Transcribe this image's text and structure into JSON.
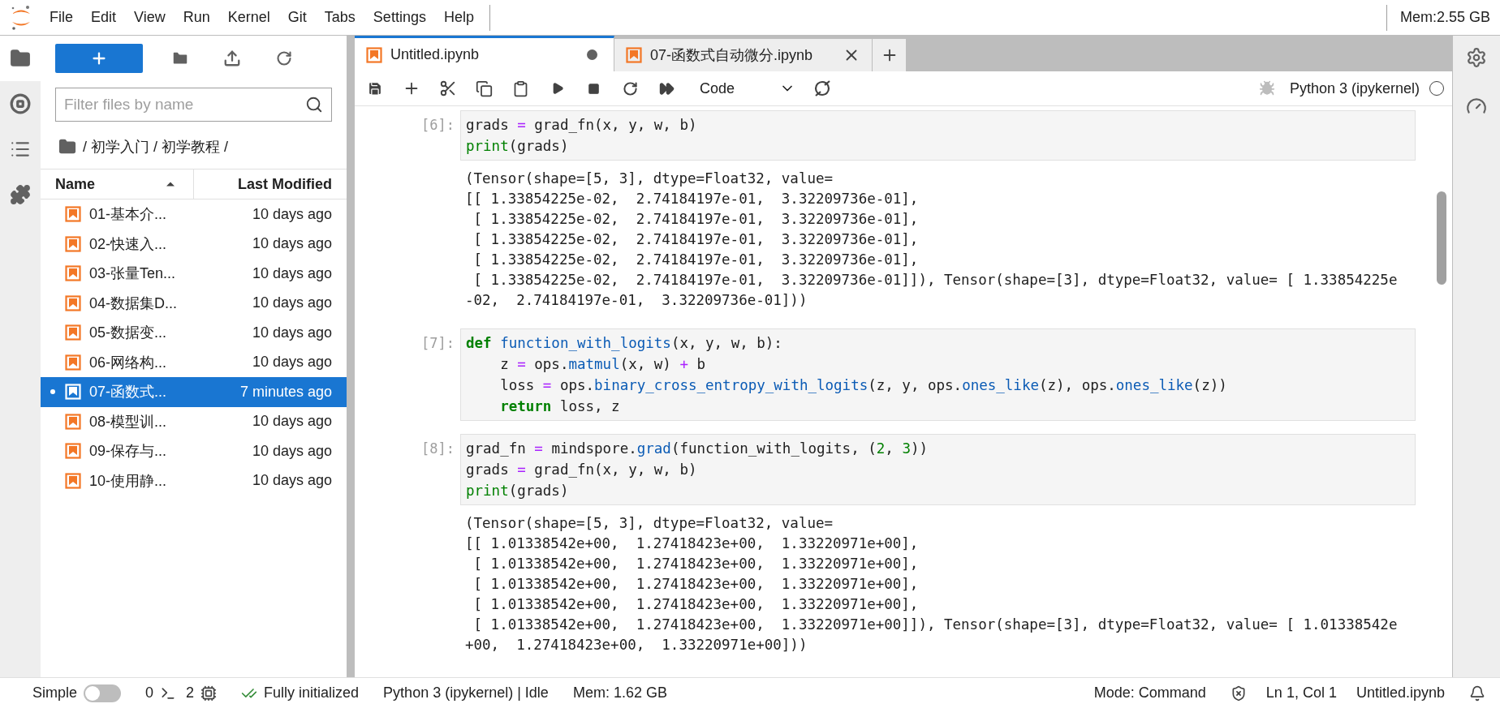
{
  "menu": [
    "File",
    "Edit",
    "View",
    "Run",
    "Kernel",
    "Git",
    "Tabs",
    "Settings",
    "Help"
  ],
  "top_memory": "Mem:2.55 GB",
  "side_tabs": [
    {
      "selected": true
    },
    {
      "selected": false
    },
    {
      "selected": false
    },
    {
      "selected": false
    }
  ],
  "file_browser": {
    "filter_placeholder": "Filter files by name",
    "breadcrumb": "/ 初学入门 / 初学教程 /",
    "columns": [
      {
        "label": "Name",
        "sorted": true
      },
      {
        "label": "Last Modified",
        "sorted": false
      }
    ],
    "files": [
      {
        "name": "01-基本介...",
        "modified": "10 days ago",
        "selected": false,
        "running": false
      },
      {
        "name": "02-快速入...",
        "modified": "10 days ago",
        "selected": false,
        "running": false
      },
      {
        "name": "03-张量Ten...",
        "modified": "10 days ago",
        "selected": false,
        "running": false
      },
      {
        "name": "04-数据集D...",
        "modified": "10 days ago",
        "selected": false,
        "running": false
      },
      {
        "name": "05-数据变...",
        "modified": "10 days ago",
        "selected": false,
        "running": false
      },
      {
        "name": "06-网络构...",
        "modified": "10 days ago",
        "selected": false,
        "running": false
      },
      {
        "name": "07-函数式...",
        "modified": "7 minutes ago",
        "selected": true,
        "running": true
      },
      {
        "name": "08-模型训...",
        "modified": "10 days ago",
        "selected": false,
        "running": false
      },
      {
        "name": "09-保存与...",
        "modified": "10 days ago",
        "selected": false,
        "running": false
      },
      {
        "name": "10-使用静...",
        "modified": "10 days ago",
        "selected": false,
        "running": false
      }
    ]
  },
  "notebook": {
    "tabs": [
      {
        "label": "Untitled.ipynb",
        "selected": true,
        "dirty": true
      },
      {
        "label": "07-函数式自动微分.ipynb",
        "selected": false,
        "dirty": false
      }
    ],
    "toolbar": {
      "cell_type": "Code",
      "kernel": "Python 3 (ipykernel)",
      "kernel_busy": false
    },
    "cells": [
      {
        "prompt": "[6]:",
        "input": [
          [
            {
              "kind": "p",
              "text": "grads "
            },
            {
              "kind": "op",
              "text": "="
            },
            {
              "kind": "p",
              "text": " grad_fn(x, y, w, b)"
            }
          ],
          [
            {
              "kind": "bi",
              "text": "print"
            },
            {
              "kind": "p",
              "text": "(grads)"
            }
          ]
        ],
        "output": [
          "(Tensor(shape=[5, 3], dtype=Float32, value=",
          "[[ 1.33854225e-02,  2.74184197e-01,  3.32209736e-01],",
          " [ 1.33854225e-02,  2.74184197e-01,  3.32209736e-01],",
          " [ 1.33854225e-02,  2.74184197e-01,  3.32209736e-01],",
          " [ 1.33854225e-02,  2.74184197e-01,  3.32209736e-01],",
          " [ 1.33854225e-02,  2.74184197e-01,  3.32209736e-01]]), Tensor(shape=[3], dtype=Float32, value= [ 1.33854225e",
          "-02,  2.74184197e-01,  3.32209736e-01]))"
        ]
      },
      {
        "prompt": "[7]:",
        "input": [
          [
            {
              "kind": "kw",
              "text": "def"
            },
            {
              "kind": "fn",
              "text": " function_with_logits"
            },
            {
              "kind": "p",
              "text": "(x, y, w, b):"
            }
          ],
          [
            {
              "kind": "p",
              "text": "    z "
            },
            {
              "kind": "op",
              "text": "="
            },
            {
              "kind": "p",
              "text": " ops."
            },
            {
              "kind": "fn",
              "text": "matmul"
            },
            {
              "kind": "p",
              "text": "(x, w) "
            },
            {
              "kind": "op",
              "text": "+"
            },
            {
              "kind": "p",
              "text": " b"
            }
          ],
          [
            {
              "kind": "p",
              "text": "    loss "
            },
            {
              "kind": "op",
              "text": "="
            },
            {
              "kind": "p",
              "text": " ops."
            },
            {
              "kind": "fn",
              "text": "binary_cross_entropy_with_logits"
            },
            {
              "kind": "p",
              "text": "(z, y, ops."
            },
            {
              "kind": "fn",
              "text": "ones_like"
            },
            {
              "kind": "p",
              "text": "(z), ops."
            },
            {
              "kind": "fn",
              "text": "ones_like"
            },
            {
              "kind": "p",
              "text": "(z))"
            }
          ],
          [
            {
              "kind": "kw",
              "text": "    return"
            },
            {
              "kind": "p",
              "text": " loss, z"
            }
          ]
        ]
      },
      {
        "prompt": "[8]:",
        "input": [
          [
            {
              "kind": "p",
              "text": "grad_fn "
            },
            {
              "kind": "op",
              "text": "="
            },
            {
              "kind": "p",
              "text": " mindspore."
            },
            {
              "kind": "fn",
              "text": "grad"
            },
            {
              "kind": "p",
              "text": "(function_with_logits, ("
            },
            {
              "kind": "num",
              "text": "2"
            },
            {
              "kind": "p",
              "text": ", "
            },
            {
              "kind": "num",
              "text": "3"
            },
            {
              "kind": "p",
              "text": "))"
            }
          ],
          [
            {
              "kind": "p",
              "text": "grads "
            },
            {
              "kind": "op",
              "text": "="
            },
            {
              "kind": "p",
              "text": " grad_fn(x, y, w, b)"
            }
          ],
          [
            {
              "kind": "bi",
              "text": "print"
            },
            {
              "kind": "p",
              "text": "(grads)"
            }
          ]
        ],
        "output": [
          "(Tensor(shape=[5, 3], dtype=Float32, value=",
          "[[ 1.01338542e+00,  1.27418423e+00,  1.33220971e+00],",
          " [ 1.01338542e+00,  1.27418423e+00,  1.33220971e+00],",
          " [ 1.01338542e+00,  1.27418423e+00,  1.33220971e+00],",
          " [ 1.01338542e+00,  1.27418423e+00,  1.33220971e+00],",
          " [ 1.01338542e+00,  1.27418423e+00,  1.33220971e+00]]), Tensor(shape=[3], dtype=Float32, value= [ 1.01338542e",
          "+00,  1.27418423e+00,  1.33220971e+00]))"
        ]
      }
    ]
  },
  "status_bar": {
    "simple_label": "Simple",
    "simple_mode": false,
    "terminals": "0",
    "kernels": "2",
    "init": "Fully initialized",
    "kernel_status": "Python 3 (ipykernel) | Idle",
    "memory": "Mem: 1.62 GB",
    "mode": "Mode: Command",
    "cursor": "Ln 1, Col 1",
    "file": "Untitled.ipynb"
  }
}
